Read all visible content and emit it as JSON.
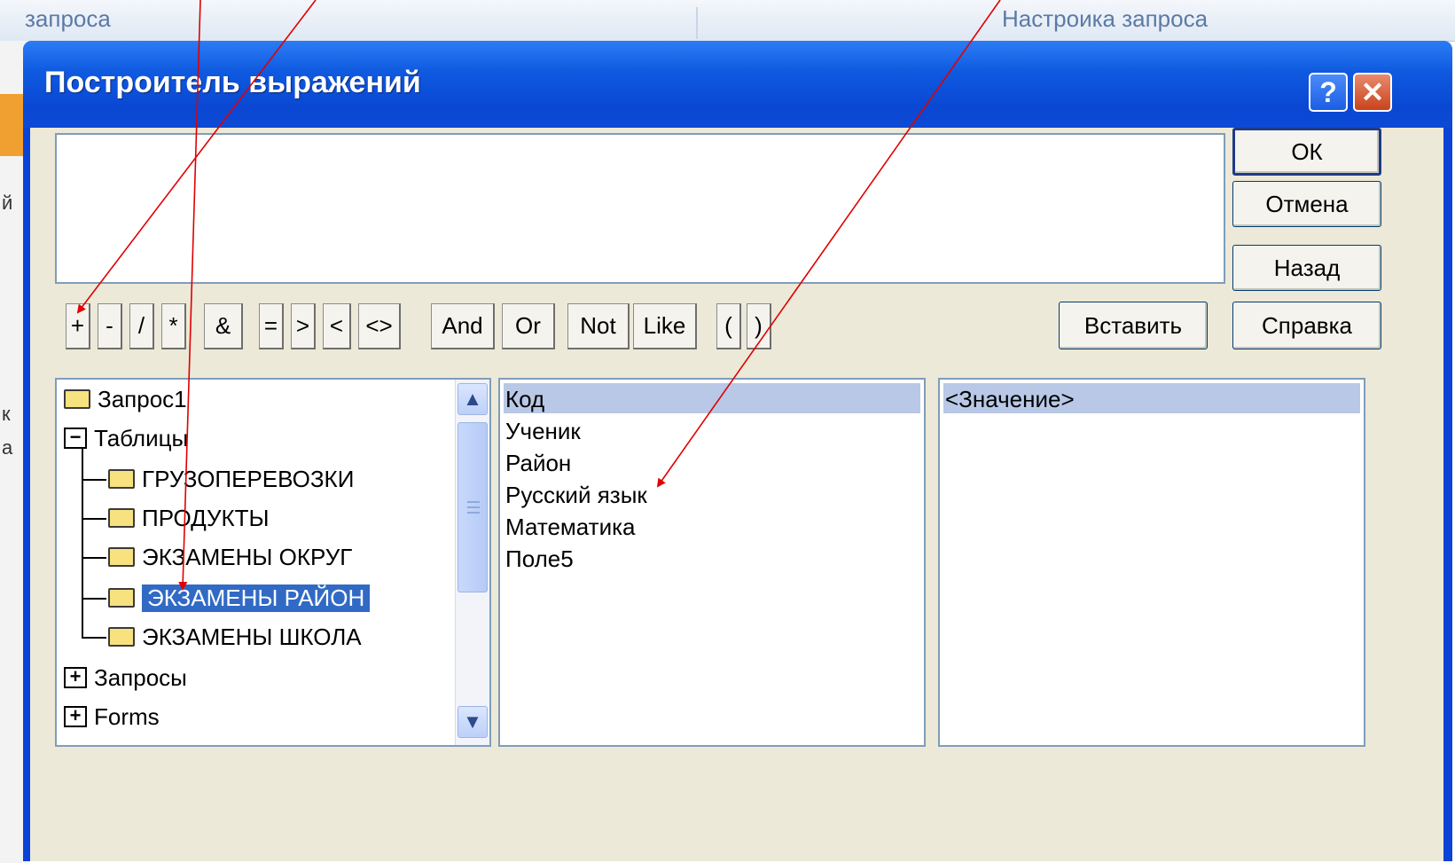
{
  "background": {
    "tab_left": "запроса",
    "tab_right": "Настроика запроса",
    "left_fragments": [
      "й",
      "к",
      "а"
    ]
  },
  "dialog": {
    "title": "Построитель выражений",
    "help_symbol": "?",
    "close_symbol": "✕"
  },
  "buttons": {
    "ok": "ОК",
    "cancel": "Отмена",
    "back": "Назад",
    "insert": "Вставить",
    "help": "Справка"
  },
  "operators": [
    "+",
    "-",
    "/",
    "*",
    "&",
    "=",
    ">",
    "<",
    "<>",
    "And",
    "Or",
    "Not",
    "Like",
    "(",
    ")"
  ],
  "tree": {
    "items": [
      {
        "label": "Запрос1",
        "type": "folder"
      },
      {
        "label": "Таблицы",
        "type": "expanded"
      },
      {
        "label": "ГРУЗОПЕРЕВОЗКИ",
        "type": "child"
      },
      {
        "label": "ПРОДУКТЫ",
        "type": "child"
      },
      {
        "label": "ЭКЗАМЕНЫ ОКРУГ",
        "type": "child"
      },
      {
        "label": "ЭКЗАМЕНЫ РАЙОН",
        "type": "child-selected"
      },
      {
        "label": "ЭКЗАМЕНЫ ШКОЛА",
        "type": "child"
      },
      {
        "label": "Запросы",
        "type": "collapsed"
      },
      {
        "label": "Forms",
        "type": "collapsed"
      }
    ]
  },
  "fields": [
    "Код",
    "Ученик",
    "Район",
    "Русский язык",
    "Математика",
    "Поле5"
  ],
  "values": [
    "<Значение>"
  ],
  "annotation_color": "#e00000"
}
